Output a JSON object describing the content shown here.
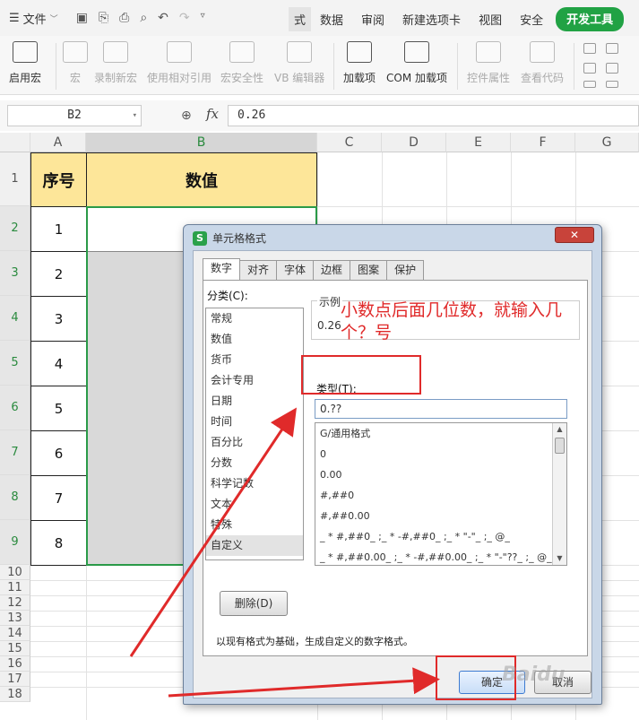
{
  "menubar": {
    "file_label": "文件",
    "tabs": [
      "式",
      "数据",
      "审阅",
      "新建选项卡",
      "视图",
      "安全",
      "开发工具"
    ]
  },
  "ribbon": {
    "buttons": [
      "启用宏",
      "宏",
      "录制新宏",
      "使用相对引用",
      "宏安全性",
      "VB 编辑器",
      "加载项",
      "COM 加载项",
      "控件属性",
      "查看代码"
    ]
  },
  "formula_bar": {
    "name_box": "B2",
    "fx_label": "fx",
    "value": "0.26"
  },
  "grid": {
    "columns": [
      "A",
      "B",
      "C",
      "D",
      "E",
      "F",
      "G"
    ],
    "rows": [
      "1",
      "2",
      "3",
      "4",
      "5",
      "6",
      "7",
      "8",
      "9",
      "10",
      "11",
      "12",
      "13",
      "14",
      "15",
      "16",
      "17",
      "18"
    ],
    "header": {
      "a1": "序号",
      "b1": "数值"
    },
    "serials": [
      "1",
      "2",
      "3",
      "4",
      "5",
      "6",
      "7",
      "8"
    ]
  },
  "dialog": {
    "title": "单元格格式",
    "logo": "S",
    "close": "✕",
    "tabs": [
      "数字",
      "对齐",
      "字体",
      "边框",
      "图案",
      "保护"
    ],
    "category_label": "分类(C):",
    "categories": [
      "常规",
      "数值",
      "货币",
      "会计专用",
      "日期",
      "时间",
      "百分比",
      "分数",
      "科学记数",
      "文本",
      "特殊",
      "自定义"
    ],
    "sample_label": "示例",
    "sample_value": "0.26",
    "type_label": "类型(T):",
    "type_value": "0.??",
    "formats": [
      "G/通用格式",
      "0",
      "0.00",
      "#,##0",
      "#,##0.00",
      "_ * #,##0_ ;_ * -#,##0_ ;_ * \"-\"_ ;_ @_",
      "_ * #,##0.00_ ;_ * -#,##0.00_ ;_ * \"-\"??_ ;_ @_"
    ],
    "delete_button": "删除(D)",
    "description": "以现有格式为基础，生成自定义的数字格式。",
    "ok_button": "确定",
    "cancel_button": "取消"
  },
  "annotation": {
    "text": "小数点后面几位数，就输入几个？号"
  },
  "watermark": "Baidu",
  "colors": {
    "accent_green": "#21a244",
    "header_fill": "#fde699",
    "annotation_red": "#e02a2a"
  }
}
